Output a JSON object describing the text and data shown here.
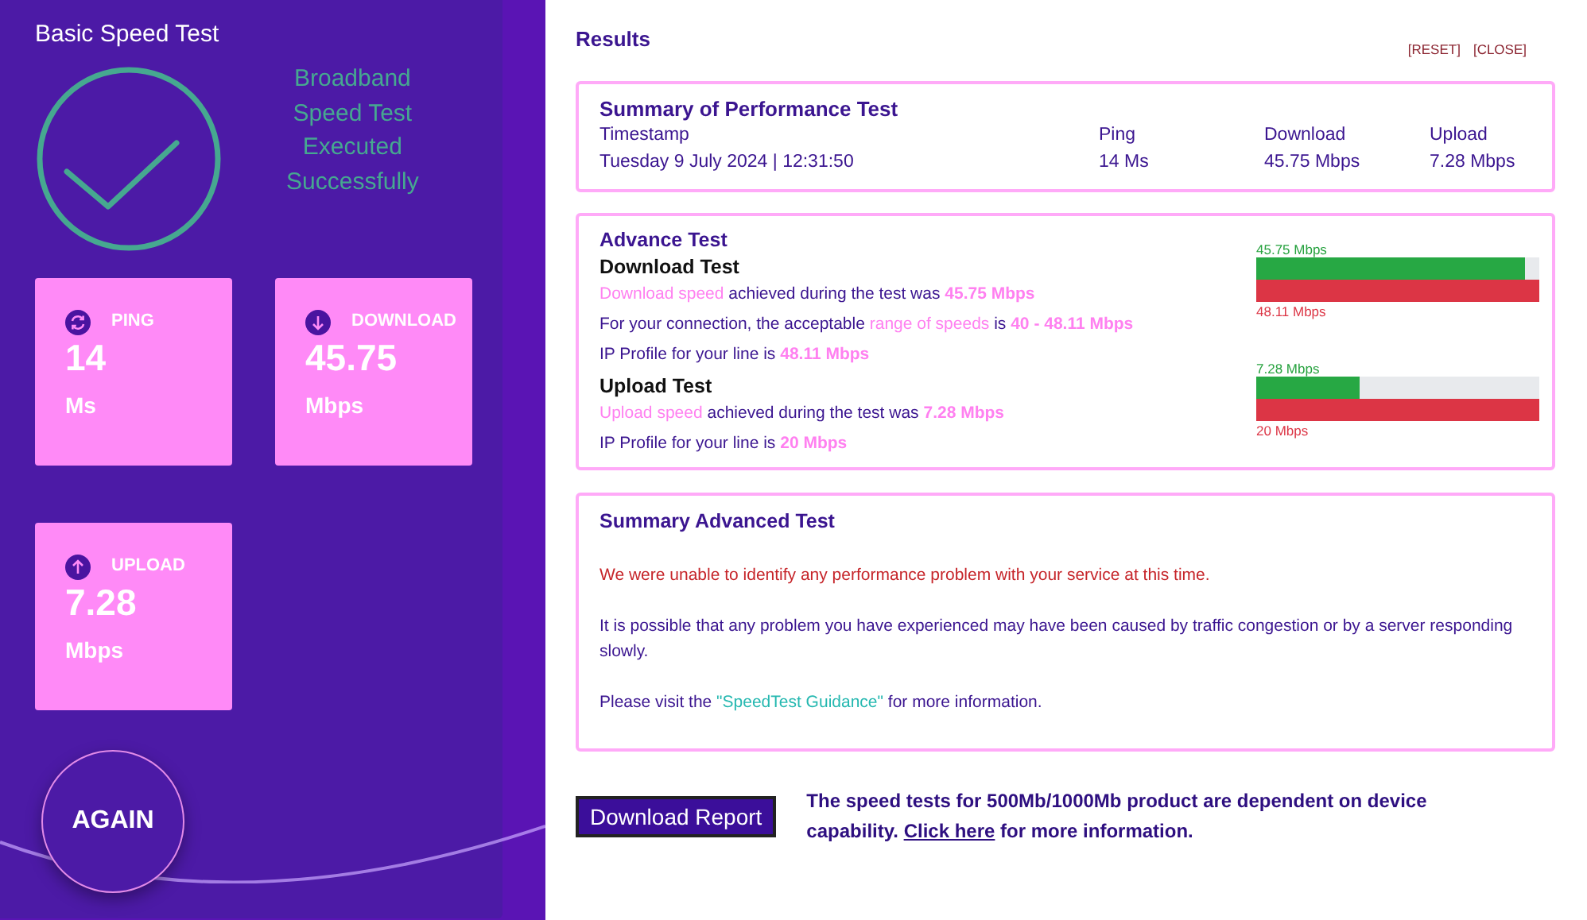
{
  "left": {
    "title": "Basic Speed Test",
    "status_lines": [
      "Broadband",
      "Speed Test",
      "Executed",
      "Successfully"
    ],
    "tiles": [
      {
        "kind": "ping",
        "label": "PING",
        "value": "14",
        "unit": "Ms"
      },
      {
        "kind": "download",
        "label": "DOWNLOAD",
        "value": "45.75",
        "unit": "Mbps"
      },
      {
        "kind": "upload",
        "label": "UPLOAD",
        "value": "7.28",
        "unit": "Mbps"
      }
    ],
    "again_button": "AGAIN"
  },
  "results": {
    "title": "Results",
    "actions": [
      "[RESET]",
      "[CLOSE]"
    ],
    "summary": {
      "title": "Summary of Performance Test",
      "columns": [
        {
          "label": "Timestamp",
          "value": "Tuesday 9 July 2024 | 12:31:50"
        },
        {
          "label": "Ping",
          "value": "14 Ms"
        },
        {
          "label": "Download",
          "value": "45.75 Mbps"
        },
        {
          "label": "Upload",
          "value": "7.28 Mbps"
        }
      ]
    },
    "advance": {
      "title": "Advance Test",
      "sections": [
        {
          "heading": "Download Test",
          "lines": [
            [
              {
                "kind": "accent",
                "text": "Download speed"
              },
              {
                "kind": "plain",
                "text": " achieved during the test was "
              },
              {
                "kind": "strong",
                "text": "45.75 Mbps"
              }
            ],
            [
              {
                "kind": "plain",
                "text": "For your connection, the acceptable "
              },
              {
                "kind": "accent",
                "text": "range of speeds"
              },
              {
                "kind": "plain",
                "text": " is "
              },
              {
                "kind": "strong",
                "text": "40 - 48.11 Mbps"
              }
            ],
            [
              {
                "kind": "plain",
                "text": "IP Profile for your line is "
              },
              {
                "kind": "strong",
                "text": "48.11 Mbps"
              }
            ]
          ],
          "bar": {
            "measured": "45.75 Mbps",
            "level": 0.95,
            "profile": "48.11 Mbps"
          }
        },
        {
          "heading": "Upload Test",
          "lines": [
            [
              {
                "kind": "accent",
                "text": "Upload speed"
              },
              {
                "kind": "plain",
                "text": " achieved during the test was "
              },
              {
                "kind": "strong",
                "text": "7.28 Mbps"
              }
            ],
            [
              {
                "kind": "plain",
                "text": "IP Profile for your line is "
              },
              {
                "kind": "strong",
                "text": "20 Mbps"
              }
            ]
          ],
          "bar": {
            "measured": "7.28 Mbps",
            "level": 0.364,
            "profile": "20 Mbps"
          }
        }
      ]
    },
    "advanced_summary": {
      "title": "Summary Advanced Test",
      "warning": "We were unable to identify any performance problem with your service at this time.",
      "info": "It is possible that any problem you have experienced may have been caused by traffic congestion or by a server responding slowly.",
      "visit_before": "Please visit the ",
      "visit_link": "\"SpeedTest Guidance\"",
      "visit_after": " for more information."
    },
    "download_report_button": "Download Report",
    "note_before": "The speed tests for 500Mb/1000Mb product are dependent on device capability. ",
    "note_link": "Click here",
    "note_after": " for more information."
  }
}
